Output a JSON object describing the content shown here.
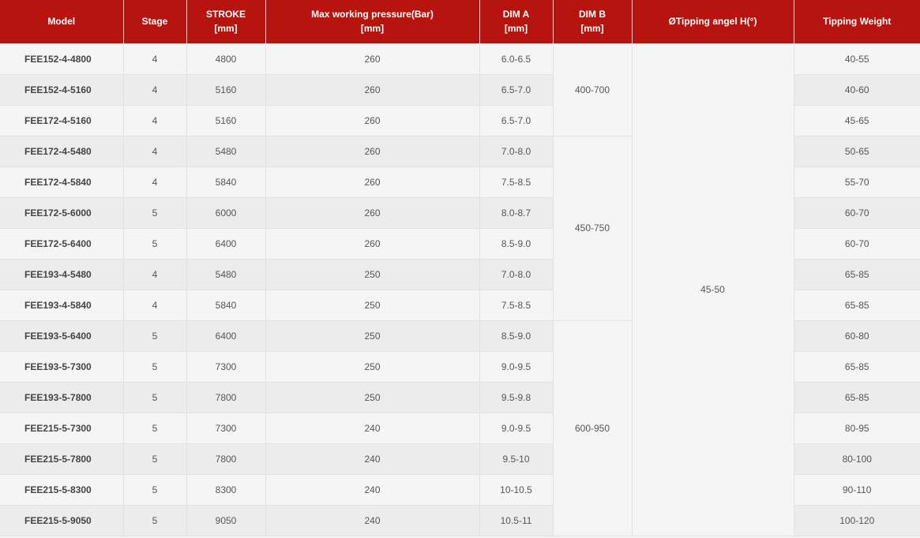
{
  "headers": {
    "model": "Model",
    "stage": "Stage",
    "stroke_l1": "STROKE",
    "stroke_l2": "[mm]",
    "pressure_l1": "Max working pressure(Bar)",
    "pressure_l2": "[mm]",
    "dima_l1": "DIM A",
    "dima_l2": "[mm]",
    "dimb_l1": "DIM B",
    "dimb_l2": "[mm]",
    "tipping_angle": "ØTipping angel H(°)",
    "tipping_weight": "Tipping Weight"
  },
  "dimb_groups": [
    "400-700",
    "450-750",
    "600-950"
  ],
  "tipping_angle_value": "45-50",
  "rows": [
    {
      "model": "FEE152-4-4800",
      "stage": "4",
      "stroke": "4800",
      "pressure": "260",
      "dima": "6.0-6.5",
      "weight": "40-55"
    },
    {
      "model": "FEE152-4-5160",
      "stage": "4",
      "stroke": "5160",
      "pressure": "260",
      "dima": "6.5-7.0",
      "weight": "40-60"
    },
    {
      "model": "FEE172-4-5160",
      "stage": "4",
      "stroke": "5160",
      "pressure": "260",
      "dima": "6.5-7.0",
      "weight": "45-65"
    },
    {
      "model": "FEE172-4-5480",
      "stage": "4",
      "stroke": "5480",
      "pressure": "260",
      "dima": "7.0-8.0",
      "weight": "50-65"
    },
    {
      "model": "FEE172-4-5840",
      "stage": "4",
      "stroke": "5840",
      "pressure": "260",
      "dima": "7.5-8.5",
      "weight": "55-70"
    },
    {
      "model": "FEE172-5-6000",
      "stage": "5",
      "stroke": "6000",
      "pressure": "260",
      "dima": "8.0-8.7",
      "weight": "60-70"
    },
    {
      "model": "FEE172-5-6400",
      "stage": "5",
      "stroke": "6400",
      "pressure": "260",
      "dima": "8.5-9.0",
      "weight": "60-70"
    },
    {
      "model": "FEE193-4-5480",
      "stage": "4",
      "stroke": "5480",
      "pressure": "250",
      "dima": "7.0-8.0",
      "weight": "65-85"
    },
    {
      "model": "FEE193-4-5840",
      "stage": "4",
      "stroke": "5840",
      "pressure": "250",
      "dima": "7.5-8.5",
      "weight": "65-85"
    },
    {
      "model": "FEE193-5-6400",
      "stage": "5",
      "stroke": "6400",
      "pressure": "250",
      "dima": "8.5-9.0",
      "weight": "60-80"
    },
    {
      "model": "FEE193-5-7300",
      "stage": "5",
      "stroke": "7300",
      "pressure": "250",
      "dima": "9.0-9.5",
      "weight": "65-85"
    },
    {
      "model": "FEE193-5-7800",
      "stage": "5",
      "stroke": "7800",
      "pressure": "250",
      "dima": "9.5-9.8",
      "weight": "65-85"
    },
    {
      "model": "FEE215-5-7300",
      "stage": "5",
      "stroke": "7300",
      "pressure": "240",
      "dima": "9.0-9.5",
      "weight": "80-95"
    },
    {
      "model": "FEE215-5-7800",
      "stage": "5",
      "stroke": "7800",
      "pressure": "240",
      "dima": "9.5-10",
      "weight": "80-100"
    },
    {
      "model": "FEE215-5-8300",
      "stage": "5",
      "stroke": "8300",
      "pressure": "240",
      "dima": "10-10.5",
      "weight": "90-110"
    },
    {
      "model": "FEE215-5-9050",
      "stage": "5",
      "stroke": "9050",
      "pressure": "240",
      "dima": "10.5-11",
      "weight": "100-120"
    }
  ]
}
